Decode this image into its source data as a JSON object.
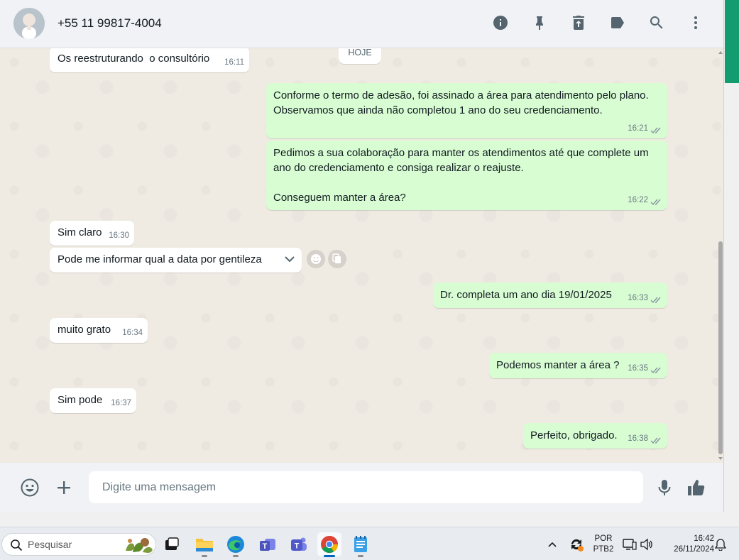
{
  "header": {
    "contact_name": "+55 11 99817-4004",
    "icons": [
      "info-icon",
      "pin-icon",
      "delete-icon",
      "label-icon",
      "search-icon",
      "menu-icon"
    ]
  },
  "chat": {
    "date_chip": "HOJE",
    "messages": [
      {
        "dir": "in",
        "text": "Os reestruturando  o consultório",
        "time": "16:11"
      },
      {
        "dir": "out",
        "text": "Conforme o termo de adesão, foi assinado a área para atendimento pelo plano. Observamos que ainda não completou 1 ano do seu credenciamento.",
        "time": "16:21"
      },
      {
        "dir": "out",
        "text": "Pedimos a sua colaboração para manter os atendimentos até que complete um ano do credenciamento e consiga realizar o reajuste.\n\nConseguem manter a área?",
        "time": "16:22"
      },
      {
        "dir": "in",
        "text": "Sim claro",
        "time": "16:30"
      },
      {
        "dir": "in",
        "text": "Pode me informar qual a data por gentileza",
        "time": ""
      },
      {
        "dir": "out",
        "text": "Dr. completa um ano dia 19/01/2025",
        "time": "16:33"
      },
      {
        "dir": "in",
        "text": "muito grato",
        "time": "16:34"
      },
      {
        "dir": "out",
        "text": "Podemos manter a área ?",
        "time": "16:35"
      },
      {
        "dir": "in",
        "text": "Sim pode",
        "time": "16:37"
      },
      {
        "dir": "out",
        "text": "Perfeito, obrigado.",
        "time": "16:38"
      }
    ]
  },
  "footer": {
    "input_placeholder": "Digite uma mensagem"
  },
  "taskbar": {
    "search_placeholder": "Pesquisar",
    "language_top": "POR",
    "language_bottom": "PTB2",
    "time": "16:42",
    "date": "26/11/2024"
  },
  "colors": {
    "outgoing_bubble": "#d9fdd3",
    "incoming_bubble": "#ffffff",
    "chat_background": "#efeae2",
    "tick_blue": "#8696a0",
    "accent": "#129c6f"
  }
}
